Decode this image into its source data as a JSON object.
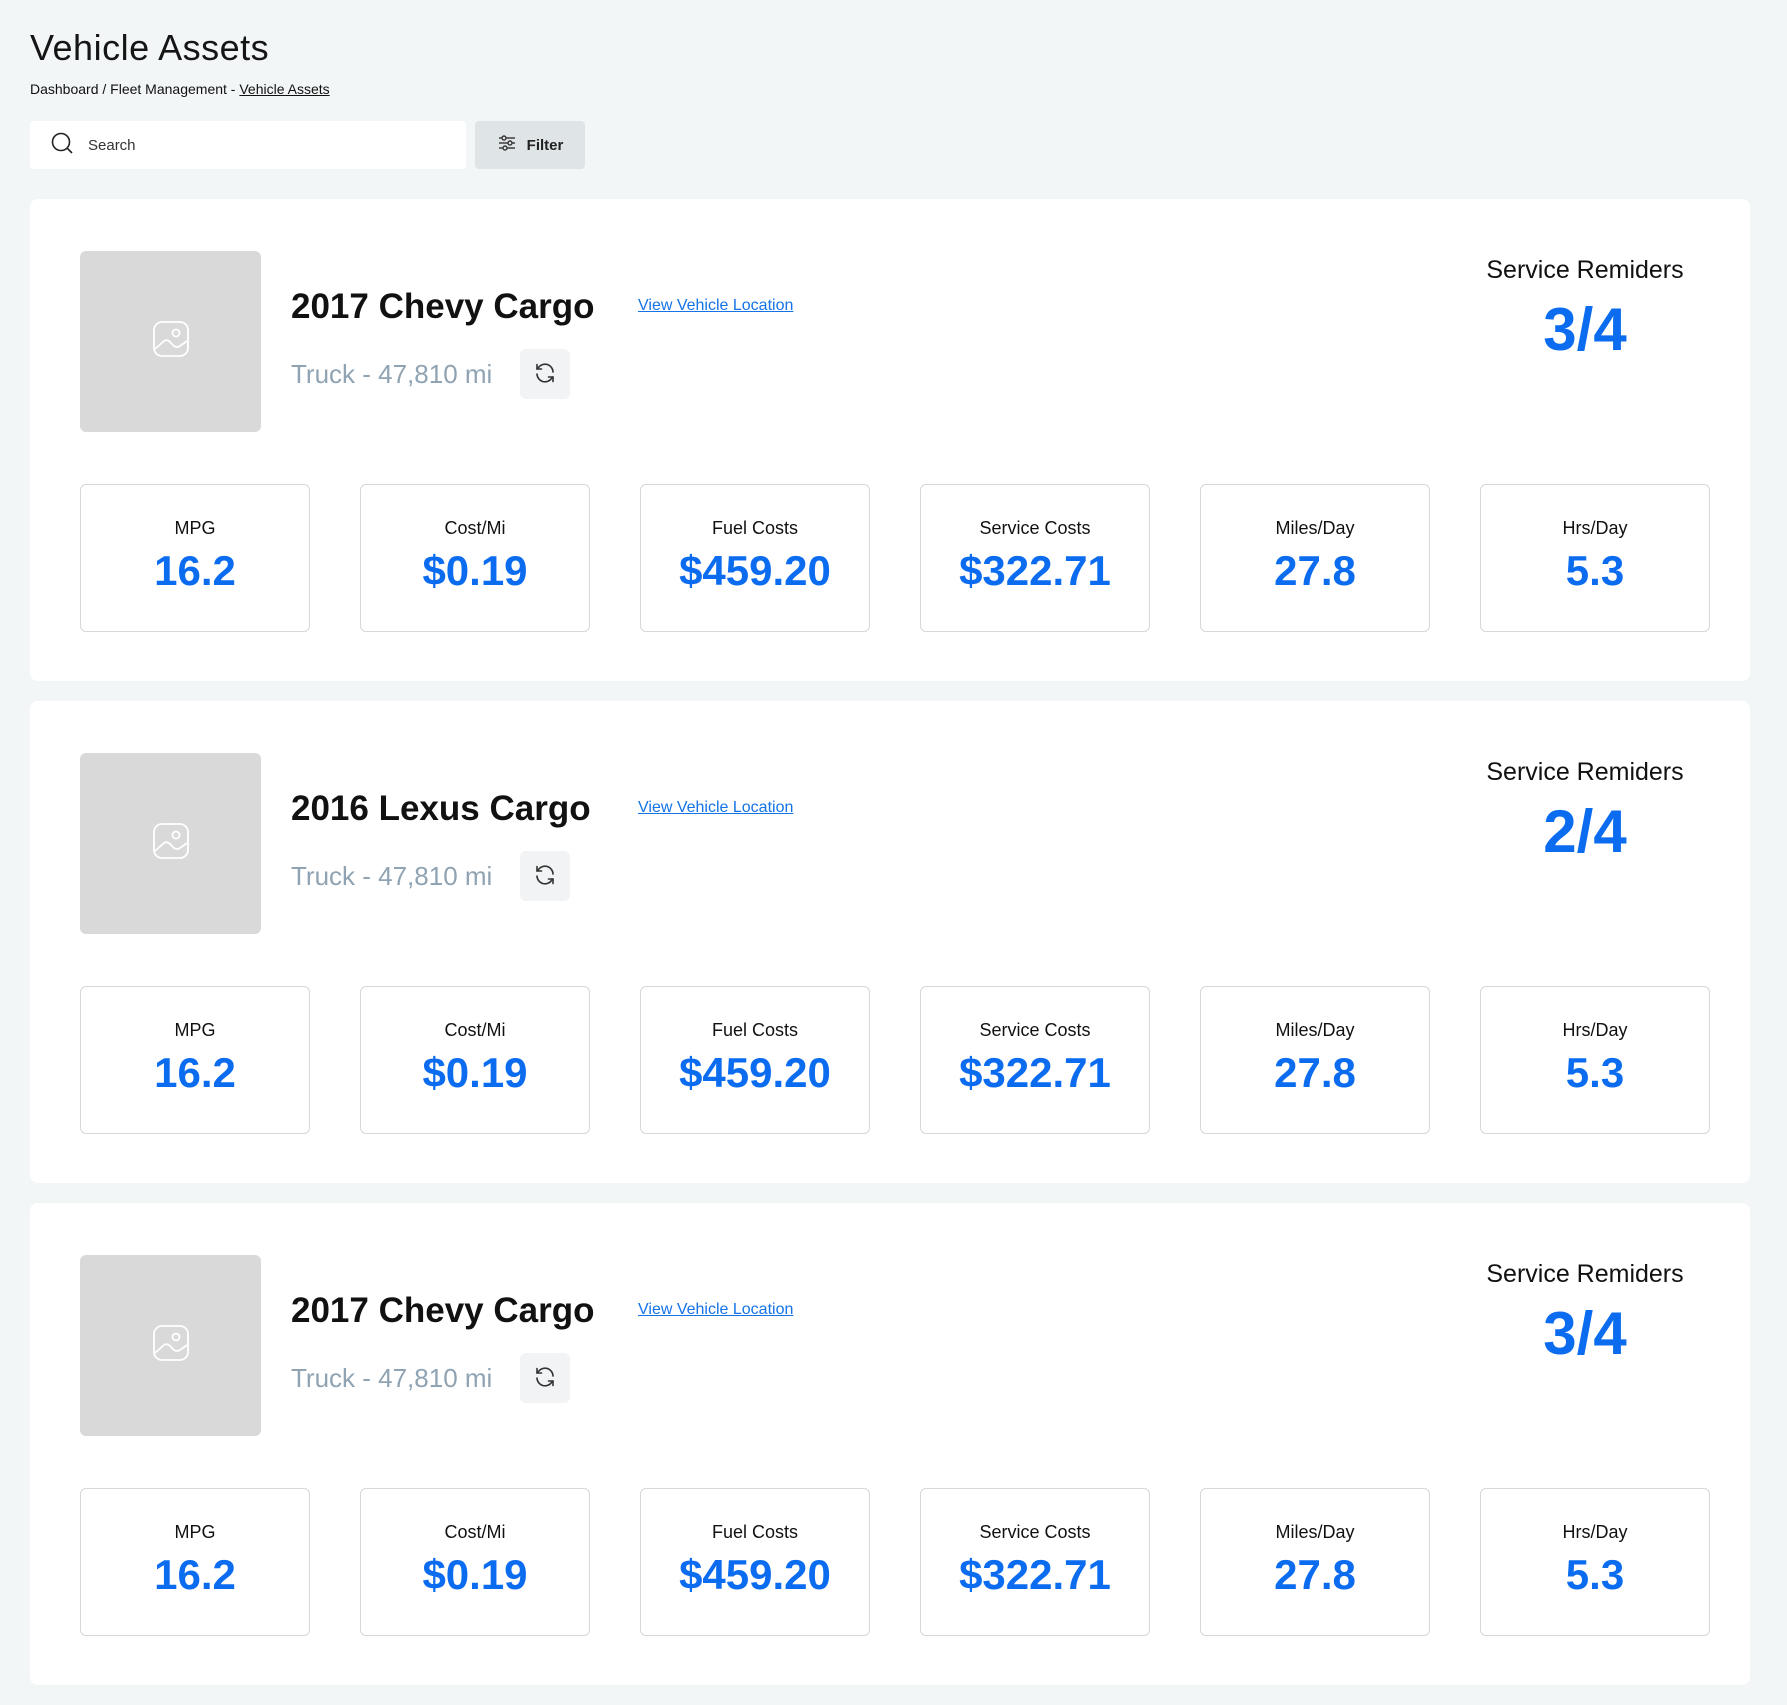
{
  "header": {
    "title": "Vehicle Assets",
    "breadcrumb": {
      "part1": "Dashboard",
      "sep1": " / ",
      "part2": "Fleet Management",
      "sep2": " - ",
      "current": "Vehicle Assets"
    }
  },
  "toolbar": {
    "search_placeholder": "Search",
    "filter_label": "Filter"
  },
  "vehicles": [
    {
      "name": "2017 Chevy Cargo",
      "link": "View Vehicle Location",
      "subtitle": "Truck - 47,810 mi",
      "reminders_label": "Service Remiders",
      "reminders_value": "3/4",
      "metrics": [
        {
          "label": "MPG",
          "value": "16.2"
        },
        {
          "label": "Cost/Mi",
          "value": "$0.19"
        },
        {
          "label": "Fuel Costs",
          "value": "$459.20"
        },
        {
          "label": "Service Costs",
          "value": "$322.71"
        },
        {
          "label": "Miles/Day",
          "value": "27.8"
        },
        {
          "label": "Hrs/Day",
          "value": "5.3"
        }
      ]
    },
    {
      "name": "2016 Lexus Cargo",
      "link": "View Vehicle Location",
      "subtitle": "Truck - 47,810 mi",
      "reminders_label": "Service Remiders",
      "reminders_value": "2/4",
      "metrics": [
        {
          "label": "MPG",
          "value": "16.2"
        },
        {
          "label": "Cost/Mi",
          "value": "$0.19"
        },
        {
          "label": "Fuel Costs",
          "value": "$459.20"
        },
        {
          "label": "Service Costs",
          "value": "$322.71"
        },
        {
          "label": "Miles/Day",
          "value": "27.8"
        },
        {
          "label": "Hrs/Day",
          "value": "5.3"
        }
      ]
    },
    {
      "name": "2017 Chevy Cargo",
      "link": "View Vehicle Location",
      "subtitle": "Truck - 47,810 mi",
      "reminders_label": "Service Remiders",
      "reminders_value": "3/4",
      "metrics": [
        {
          "label": "MPG",
          "value": "16.2"
        },
        {
          "label": "Cost/Mi",
          "value": "$0.19"
        },
        {
          "label": "Fuel Costs",
          "value": "$459.20"
        },
        {
          "label": "Service Costs",
          "value": "$322.71"
        },
        {
          "label": "Miles/Day",
          "value": "27.8"
        },
        {
          "label": "Hrs/Day",
          "value": "5.3"
        }
      ]
    }
  ],
  "colors": {
    "accent": "#0c6cf0",
    "link": "#1473e6",
    "background": "#f3f6f7",
    "subtitle": "#8fa3b3",
    "placeholder": "#d9d9d9"
  }
}
